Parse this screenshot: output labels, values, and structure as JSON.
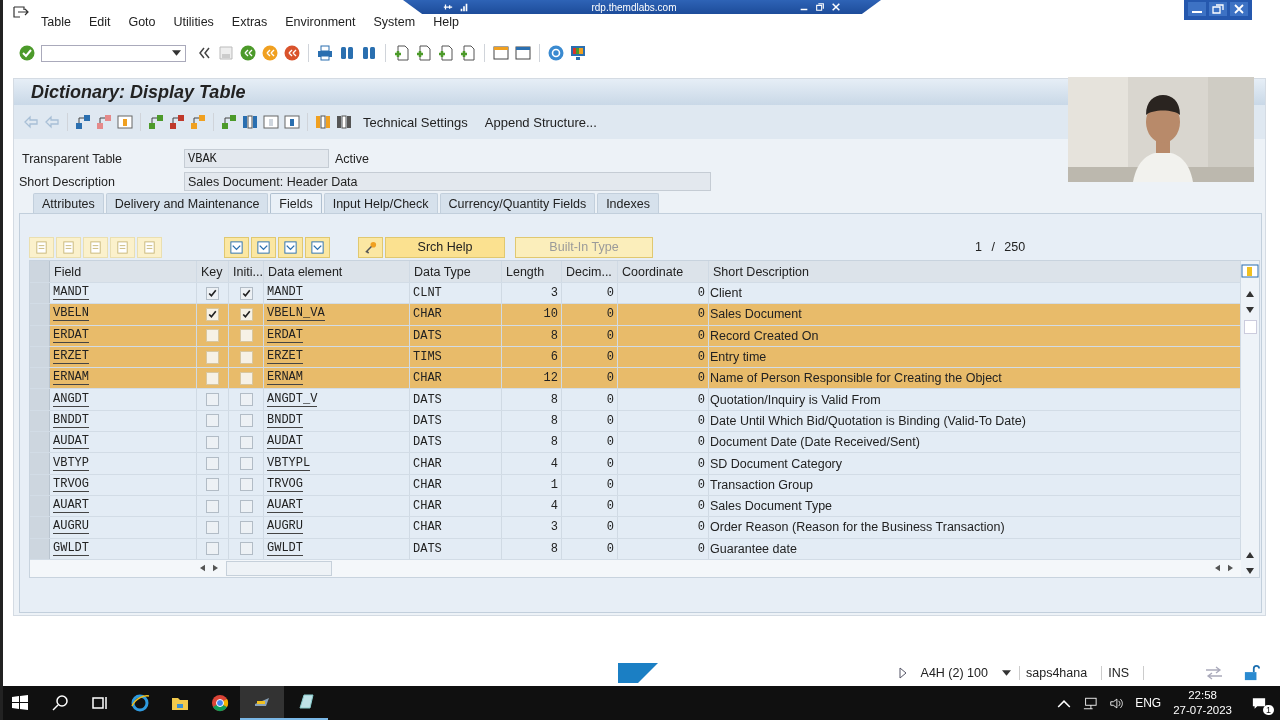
{
  "rdp_bar": {
    "host": "rdp.themdlabs.com"
  },
  "menu": [
    "Table",
    "Edit",
    "Goto",
    "Utilities",
    "Extras",
    "Environment",
    "System",
    "Help"
  ],
  "title": "Dictionary: Display Table",
  "app_toolbar": {
    "buttons": [
      "Technical Settings",
      "Append Structure..."
    ]
  },
  "header": [
    {
      "label": "Transparent Table",
      "value": "VBAK",
      "status": "Active"
    },
    {
      "label": "Short Description",
      "value": "Sales Document: Header Data"
    }
  ],
  "tabs": [
    {
      "label": "Attributes",
      "selected": false
    },
    {
      "label": "Delivery and Maintenance",
      "selected": false
    },
    {
      "label": "Fields",
      "selected": true
    },
    {
      "label": "Input Help/Check",
      "selected": false
    },
    {
      "label": "Currency/Quantity Fields",
      "selected": false
    },
    {
      "label": "Indexes",
      "selected": false
    }
  ],
  "grid_toolbar": {
    "buttons": [
      {
        "label": "Srch Help",
        "disabled": false
      },
      {
        "label": "Built-In Type",
        "disabled": true
      }
    ],
    "counter": "1 / 250"
  },
  "table": {
    "columns": [
      "Field",
      "Key",
      "Initi...",
      "Data element",
      "Data Type",
      "Length",
      "Decim...",
      "Coordinate",
      "Short Description"
    ],
    "rows": [
      {
        "field": "MANDT",
        "key": true,
        "initial": true,
        "data_element": "MANDT",
        "data_type": "CLNT",
        "length": "3",
        "decimals": "0",
        "coordinate": "0",
        "description": "Client",
        "selected": false
      },
      {
        "field": "VBELN",
        "key": true,
        "initial": true,
        "data_element": "VBELN_VA",
        "data_type": "CHAR",
        "length": "10",
        "decimals": "0",
        "coordinate": "0",
        "description": "Sales Document",
        "selected": true
      },
      {
        "field": "ERDAT",
        "key": false,
        "initial": false,
        "data_element": "ERDAT",
        "data_type": "DATS",
        "length": "8",
        "decimals": "0",
        "coordinate": "0",
        "description": "Record Created On",
        "selected": true
      },
      {
        "field": "ERZET",
        "key": false,
        "initial": false,
        "data_element": "ERZET",
        "data_type": "TIMS",
        "length": "6",
        "decimals": "0",
        "coordinate": "0",
        "description": "Entry time",
        "selected": true
      },
      {
        "field": "ERNAM",
        "key": false,
        "initial": false,
        "data_element": "ERNAM",
        "data_type": "CHAR",
        "length": "12",
        "decimals": "0",
        "coordinate": "0",
        "description": "Name of Person Responsible for Creating the Object",
        "selected": true
      },
      {
        "field": "ANGDT",
        "key": false,
        "initial": false,
        "data_element": "ANGDT_V",
        "data_type": "DATS",
        "length": "8",
        "decimals": "0",
        "coordinate": "0",
        "description": "Quotation/Inquiry is Valid From",
        "selected": false
      },
      {
        "field": "BNDDT",
        "key": false,
        "initial": false,
        "data_element": "BNDDT",
        "data_type": "DATS",
        "length": "8",
        "decimals": "0",
        "coordinate": "0",
        "description": "Date Until Which Bid/Quotation is Binding (Valid-To Date)",
        "selected": false
      },
      {
        "field": "AUDAT",
        "key": false,
        "initial": false,
        "data_element": "AUDAT",
        "data_type": "DATS",
        "length": "8",
        "decimals": "0",
        "coordinate": "0",
        "description": "Document Date (Date Received/Sent)",
        "selected": false
      },
      {
        "field": "VBTYP",
        "key": false,
        "initial": false,
        "data_element": "VBTYPL",
        "data_type": "CHAR",
        "length": "4",
        "decimals": "0",
        "coordinate": "0",
        "description": "SD Document Category",
        "selected": false
      },
      {
        "field": "TRVOG",
        "key": false,
        "initial": false,
        "data_element": "TRVOG",
        "data_type": "CHAR",
        "length": "1",
        "decimals": "0",
        "coordinate": "0",
        "description": "Transaction Group",
        "selected": false
      },
      {
        "field": "AUART",
        "key": false,
        "initial": false,
        "data_element": "AUART",
        "data_type": "CHAR",
        "length": "4",
        "decimals": "0",
        "coordinate": "0",
        "description": "Sales Document Type",
        "selected": false
      },
      {
        "field": "AUGRU",
        "key": false,
        "initial": false,
        "data_element": "AUGRU",
        "data_type": "CHAR",
        "length": "3",
        "decimals": "0",
        "coordinate": "0",
        "description": "Order Reason (Reason for the Business Transaction)",
        "selected": false
      },
      {
        "field": "GWLDT",
        "key": false,
        "initial": false,
        "data_element": "GWLDT",
        "data_type": "DATS",
        "length": "8",
        "decimals": "0",
        "coordinate": "0",
        "description": "Guarantee date",
        "selected": false
      }
    ]
  },
  "status_bar": {
    "system": "A4H (2) 100",
    "server": "saps4hana",
    "mode": "INS"
  },
  "taskbar": {
    "language": "ENG",
    "time": "22:58",
    "date": "27-07-2023",
    "notifications": "1"
  }
}
